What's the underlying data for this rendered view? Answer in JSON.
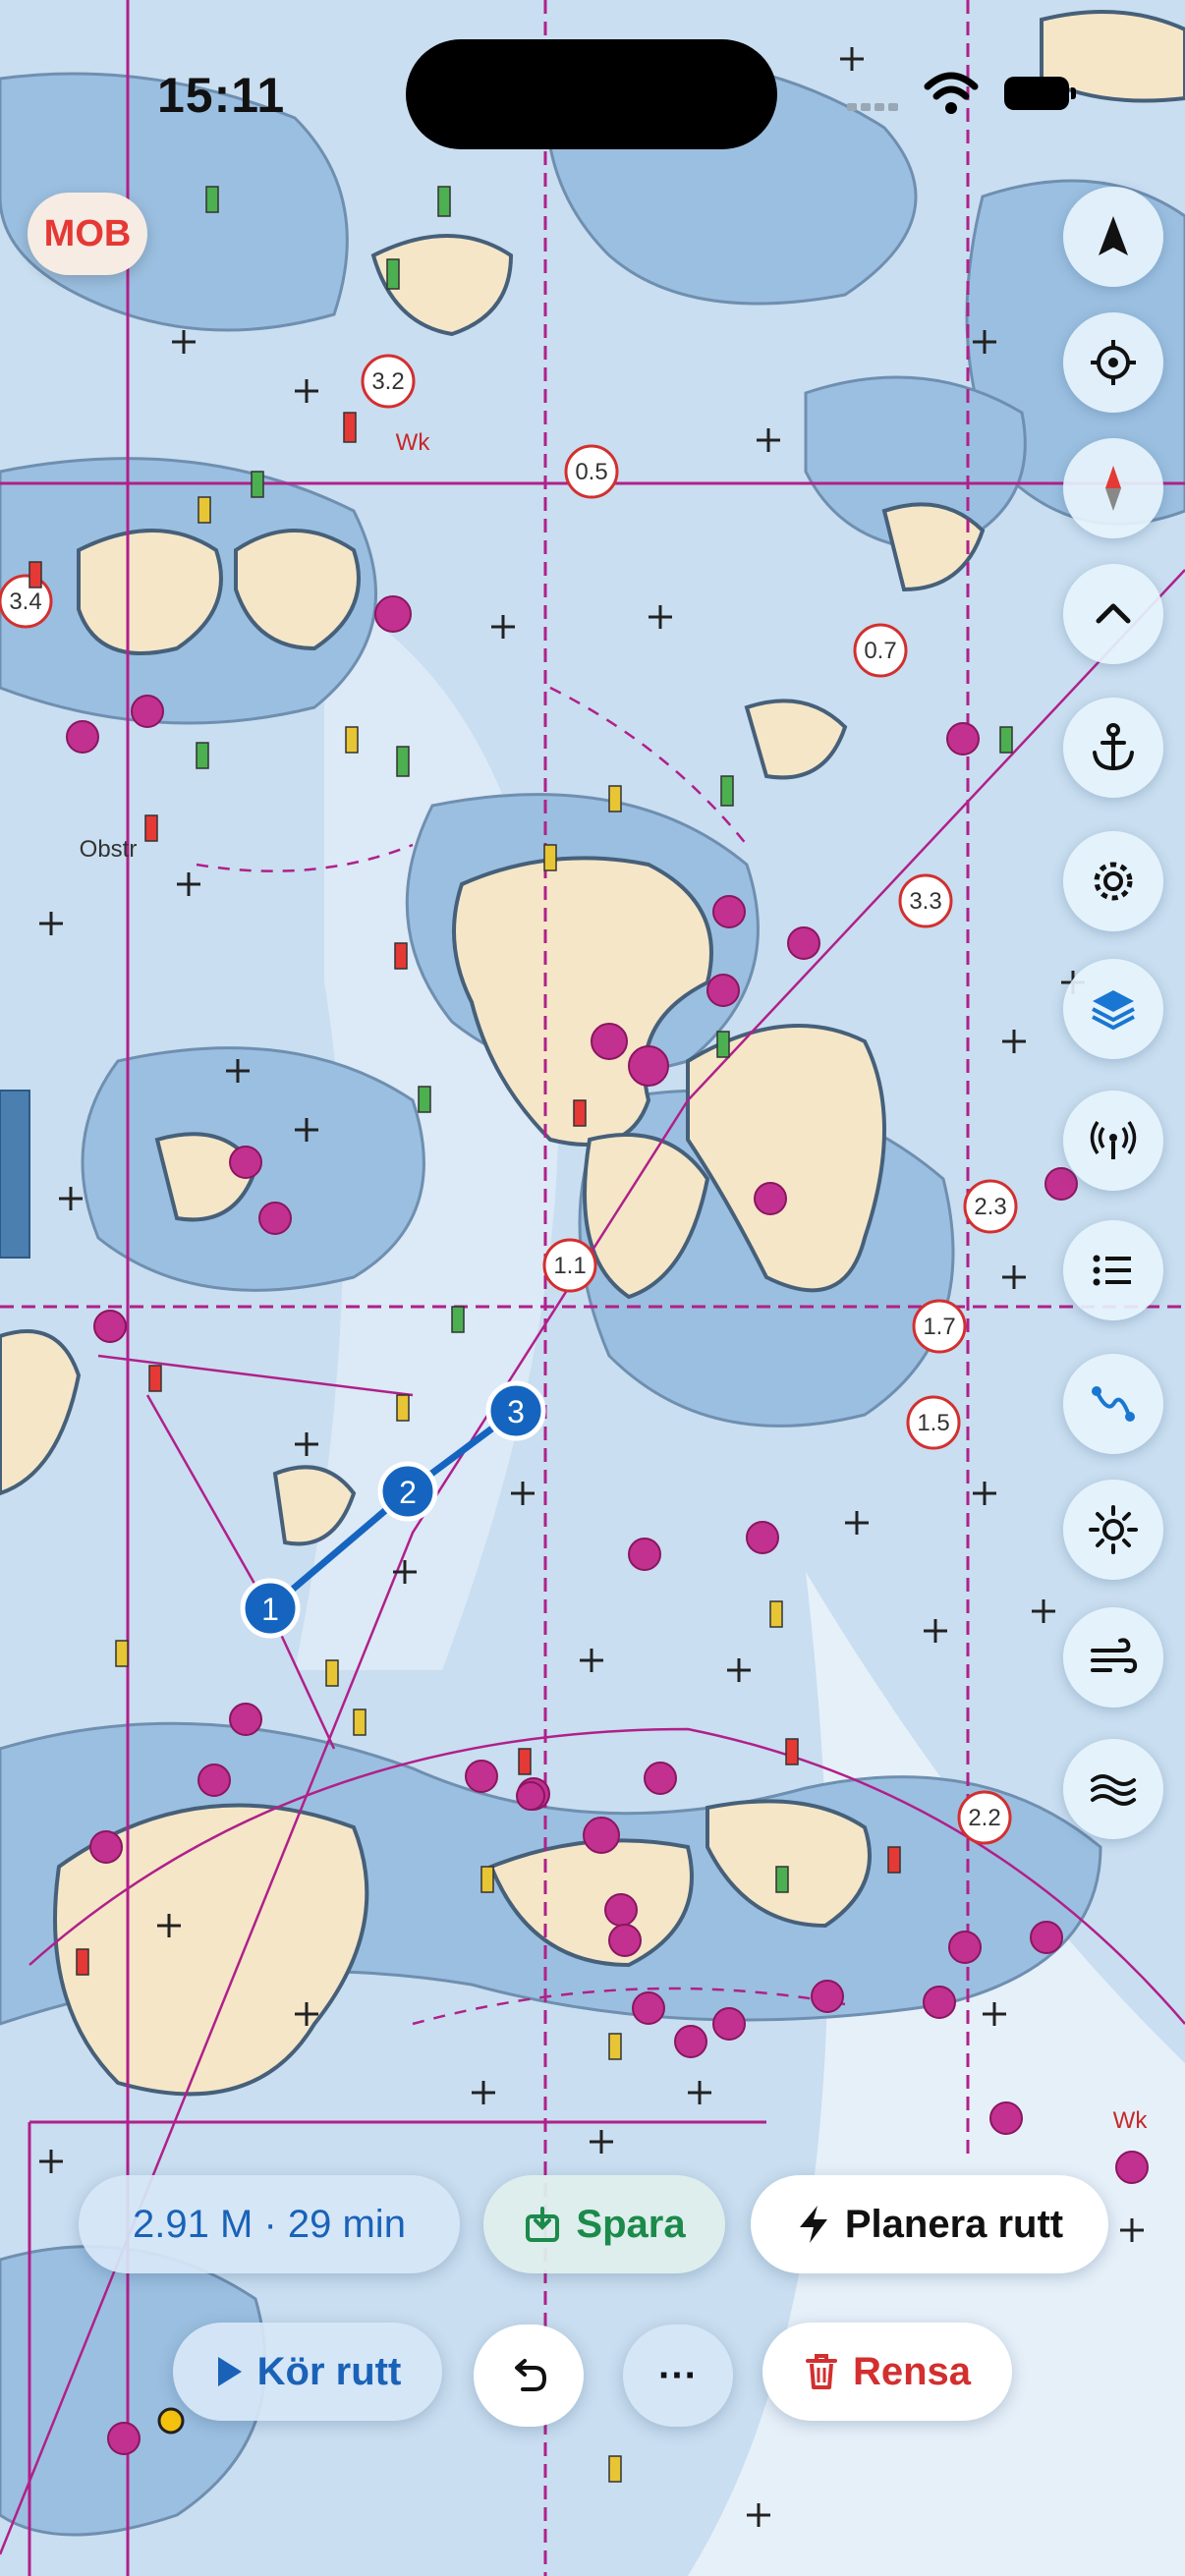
{
  "status_bar": {
    "time": "15:11"
  },
  "mob": {
    "label": "MOB"
  },
  "map": {
    "depth_labels": [
      "3.2",
      "0.5",
      "3.4",
      "0.7",
      "3.3",
      "2.3",
      "1.1",
      "1.7",
      "1.5",
      "2.2"
    ],
    "place_labels": [
      "Wk",
      "Obstr",
      "Wk"
    ],
    "route_waypoints": [
      "1",
      "2",
      "3"
    ],
    "colors": {
      "sea": "#c9def0",
      "shallow": "#9bbfe0",
      "land": "#f5e6c8",
      "route": "#1565c0",
      "cable": "#b0208a"
    }
  },
  "controls": [
    {
      "name": "navigation-icon"
    },
    {
      "name": "locate-icon"
    },
    {
      "name": "compass-icon"
    },
    {
      "name": "chevron-up-icon"
    },
    {
      "name": "anchor-icon"
    },
    {
      "name": "gear-icon"
    },
    {
      "name": "layers-icon"
    },
    {
      "name": "antenna-icon"
    },
    {
      "name": "list-icon"
    },
    {
      "name": "route-icon"
    },
    {
      "name": "sun-icon"
    },
    {
      "name": "wind-icon"
    },
    {
      "name": "waves-icon"
    }
  ],
  "bottom": {
    "route_info": "2.91 M · 29 min",
    "save_label": "Spara",
    "plan_label": "Planera rutt",
    "run_label": "Kör rutt",
    "more_label": "···",
    "clear_label": "Rensa"
  }
}
